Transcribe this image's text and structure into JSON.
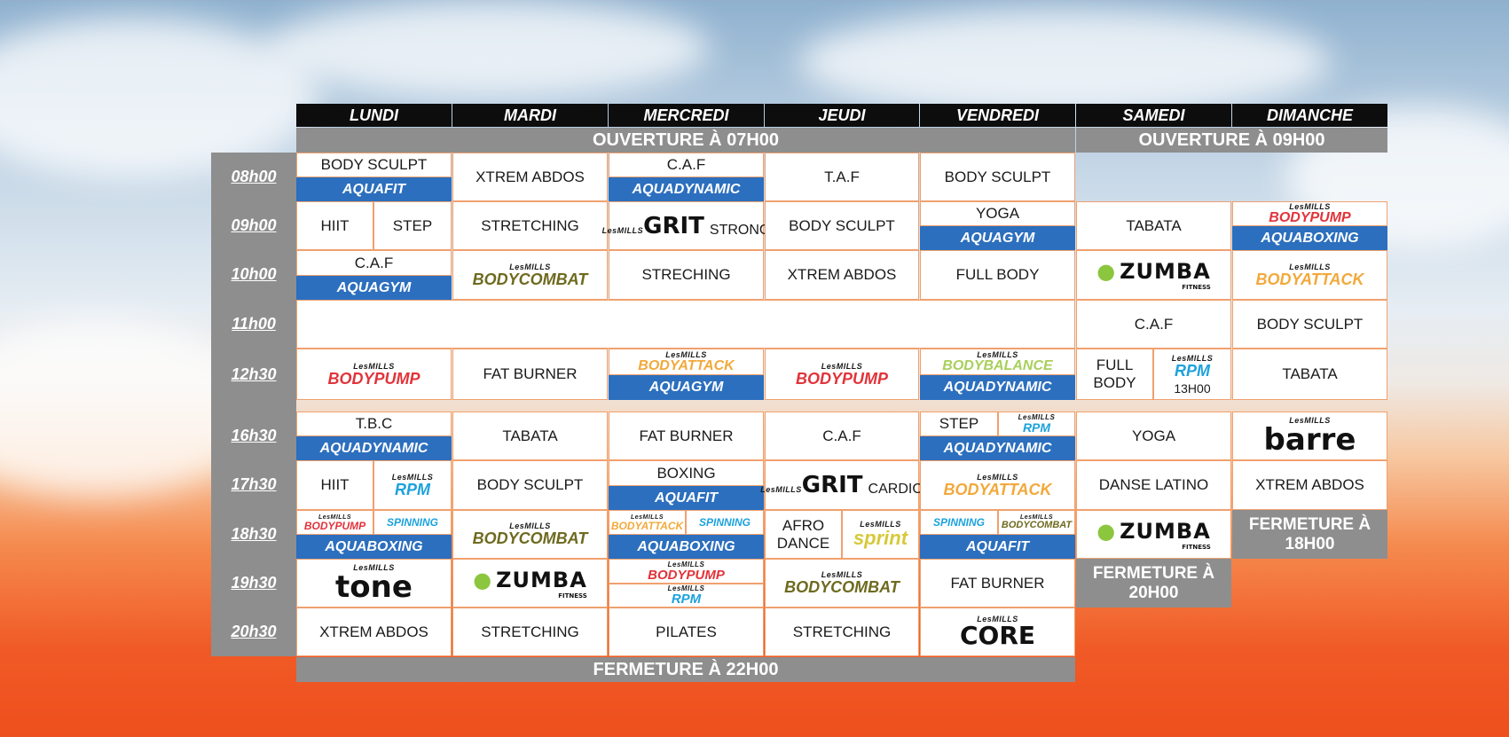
{
  "days": [
    "LUNDI",
    "MARDI",
    "MERCREDI",
    "JEUDI",
    "VENDREDI",
    "SAMEDI",
    "DIMANCHE"
  ],
  "opening": {
    "weekday": "OUVERTURE À 07H00",
    "weekend": "OUVERTURE À 09H00"
  },
  "closing": {
    "weekday": "FERMETURE À 22H00",
    "saturday": "FERMETURE À 20H00",
    "sunday": "FERMETURE À 18H00"
  },
  "times": [
    "08h00",
    "09h00",
    "10h00",
    "11h00",
    "12h30",
    "16h30",
    "17h30",
    "18h30",
    "19h30",
    "20h30"
  ],
  "brand_texts": {
    "lesmills": "LesMILLS",
    "fitness": "FITNESS"
  },
  "schedule": {
    "lundi": {
      "c08_top": "BODY SCULPT",
      "c08_bottom": "AQUAFIT",
      "c09_left": "HIIT",
      "c09_right": "STEP",
      "c10_top": "C.A.F",
      "c10_bottom": "AQUAGYM",
      "c12": "BODYPUMP",
      "c16_top": "T.B.C",
      "c16_bottom": "AQUADYNAMIC",
      "c17_left": "HIIT",
      "c17_right": "RPM",
      "c18_left": "BODYPUMP",
      "c18_right": "SPINNING",
      "c18_bottom": "AQUABOXING",
      "c19": "tone",
      "c20": "XTREM ABDOS"
    },
    "mardi": {
      "c08": "XTREM ABDOS",
      "c09": "STRETCHING",
      "c10": "BODYCOMBAT",
      "c12": "FAT BURNER",
      "c16": "TABATA",
      "c17": "BODY SCULPT",
      "c18": "BODYCOMBAT",
      "c19": "ZUMBA",
      "c20": "STRETCHING"
    },
    "mercredi": {
      "c08_top": "C.A.F",
      "c08_bottom": "AQUADYNAMIC",
      "c09_brand": "GRIT",
      "c09_sub": "STRONG",
      "c10": "STRECHING",
      "c12_top": "BODYATTACK",
      "c12_bottom": "AQUAGYM",
      "c16": "FAT BURNER",
      "c17_top": "BOXING",
      "c17_bottom": "AQUAFIT",
      "c18_left": "BODYATTACK",
      "c18_right": "SPINNING",
      "c18_bottom": "AQUABOXING",
      "c19_top": "BODYPUMP",
      "c19_bottom": "RPM",
      "c20": "PILATES"
    },
    "jeudi": {
      "c08": "T.A.F",
      "c09": "BODY SCULPT",
      "c10": "XTREM ABDOS",
      "c12": "BODYPUMP",
      "c16": "C.A.F",
      "c17_brand": "GRIT",
      "c17_sub": "CARDIO",
      "c18_left": "AFRO DANCE",
      "c18_right": "sprint",
      "c19": "BODYCOMBAT",
      "c20": "STRETCHING"
    },
    "vendredi": {
      "c08": "BODY SCULPT",
      "c09_top": "YOGA",
      "c09_bottom": "AQUAGYM",
      "c10": "FULL BODY",
      "c12_top": "BODYBALANCE",
      "c12_bottom": "AQUADYNAMIC",
      "c16_left": "STEP",
      "c16_right": "RPM",
      "c16_bottom": "AQUADYNAMIC",
      "c17": "BODYATTACK",
      "c18_left": "SPINNING",
      "c18_right": "BODYCOMBAT",
      "c18_bottom": "AQUAFIT",
      "c19": "FAT BURNER",
      "c20": "CORE"
    },
    "samedi": {
      "c09": "TABATA",
      "c10": "ZUMBA",
      "c11": "C.A.F",
      "c12_left": "FULL BODY",
      "c12_right": "RPM",
      "c12_time": "13H00",
      "c16": "YOGA",
      "c17": "DANSE LATINO",
      "c18": "ZUMBA"
    },
    "dimanche": {
      "c09_top": "BODYPUMP",
      "c09_bottom": "AQUABOXING",
      "c10": "BODYATTACK",
      "c11": "BODY SCULPT",
      "c12": "TABATA",
      "c16": "barre",
      "c17": "XTREM ABDOS"
    }
  },
  "colors": {
    "aqua_blue": "#2c6fbe",
    "bodypump": "#e2333a",
    "bodycombat": "#6e6a1f",
    "bodyattack": "#f2a93b",
    "bodybalance": "#a9cf5b",
    "rpm": "#1ca2dc",
    "sprint": "#d6c93a",
    "header_black": "#0d0d0d",
    "gray": "#8e8e8e",
    "cell_border": "#f0a06e"
  }
}
